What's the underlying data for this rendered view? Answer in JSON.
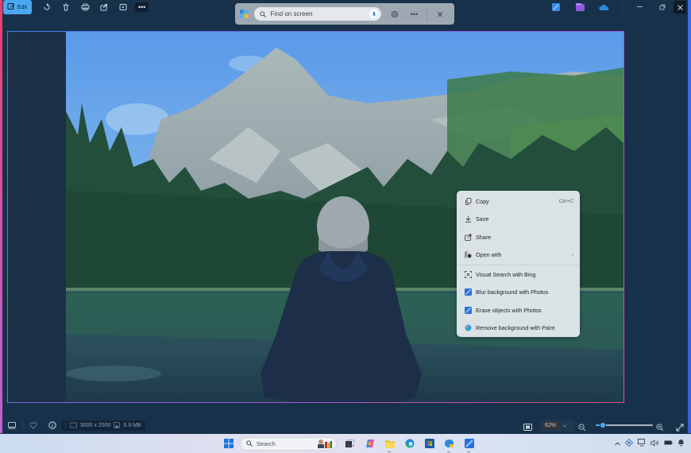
{
  "toolbar": {
    "edit_label": "Edit",
    "icons": [
      "edit-icon",
      "rotate-icon",
      "delete-icon",
      "print-icon",
      "share-icon",
      "slideshow-icon",
      "more-icon"
    ]
  },
  "findbar": {
    "placeholder": "Find on screen",
    "icons": [
      "app-logo-icon",
      "search-icon",
      "mic-icon",
      "lens-icon",
      "more-icon",
      "close-icon"
    ]
  },
  "titlebar": {
    "pinned_apps": [
      "photos-icon",
      "clipchamp-icon",
      "onedrive-icon"
    ],
    "controls": [
      "minimize",
      "restore",
      "close"
    ]
  },
  "context_menu": {
    "items": [
      {
        "label": "Copy",
        "shortcut": "Ctrl+C",
        "icon": "copy-icon"
      },
      {
        "label": "Save",
        "shortcut": "",
        "icon": "save-icon"
      },
      {
        "label": "Share",
        "shortcut": "",
        "icon": "share-icon"
      },
      {
        "label": "Open with",
        "shortcut": "",
        "icon": "open-with-icon",
        "submenu": true
      },
      {
        "label": "Visual Search with Bing",
        "shortcut": "",
        "icon": "visual-search-icon"
      },
      {
        "label": "Blur background with Photos",
        "shortcut": "",
        "icon": "photos-icon"
      },
      {
        "label": "Erase objects with Photos",
        "shortcut": "",
        "icon": "photos-icon"
      },
      {
        "label": "Remove background with Paint",
        "shortcut": "",
        "icon": "paint-icon"
      }
    ],
    "submenu_arrow": "›"
  },
  "statusbar": {
    "dimensions": "3000 x 2000",
    "filesize": "6.9 MB",
    "zoom": "62%",
    "zoom_fraction": 0.12
  },
  "taskbar": {
    "search_placeholder": "Search",
    "apps": [
      "start",
      "search",
      "widgets-avatar",
      "task-view",
      "copilot",
      "file-explorer",
      "edge",
      "microsoft-store",
      "snipping-tool",
      "photos"
    ],
    "tray": [
      "chevron-up",
      "network",
      "display",
      "volume",
      "battery",
      "notifications"
    ]
  },
  "colors": {
    "accent": "#4ba8f0",
    "background": "#18314a",
    "menu_bg": "#e2e8ec"
  }
}
